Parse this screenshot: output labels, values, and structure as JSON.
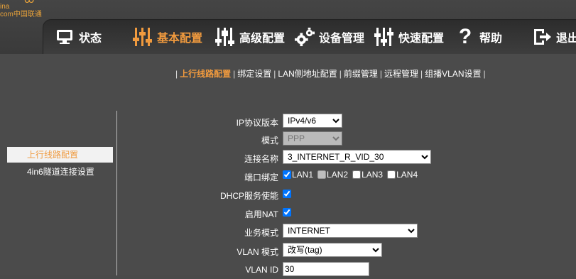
{
  "logo": {
    "line1": "ina",
    "line2": "com中国联通"
  },
  "nav": {
    "status": "状态",
    "basic": "基本配置",
    "advanced": "高级配置",
    "device": "设备管理",
    "quick": "快速配置",
    "help": "帮助",
    "logout": "退出"
  },
  "subtabs": [
    "上行线路配置",
    "绑定设置",
    "LAN侧地址配置",
    "前缀管理",
    "远程管理",
    "组播VLAN设置"
  ],
  "sidebar": {
    "items": [
      "上行线路配置",
      "4in6隧道连接设置"
    ]
  },
  "form": {
    "ip_version_label": "IP协议版本",
    "ip_version_value": "IPv4/v6",
    "mode_label": "模式",
    "mode_value": "PPP",
    "conn_name_label": "连接名称",
    "conn_name_value": "3_INTERNET_R_VID_30",
    "port_bind_label": "端口绑定",
    "ports": [
      {
        "name": "LAN1",
        "checked": true
      },
      {
        "name": "LAN2",
        "checked": false
      },
      {
        "name": "LAN3",
        "checked": false
      },
      {
        "name": "LAN4",
        "checked": false
      }
    ],
    "dhcp_label": "DHCP服务使能",
    "nat_label": "启用NAT",
    "service_label": "业务模式",
    "service_value": "INTERNET",
    "vlan_mode_label": "VLAN 模式",
    "vlan_mode_value": "改写(tag)",
    "vlan_id_label": "VLAN ID",
    "vlan_id_value": "30"
  }
}
